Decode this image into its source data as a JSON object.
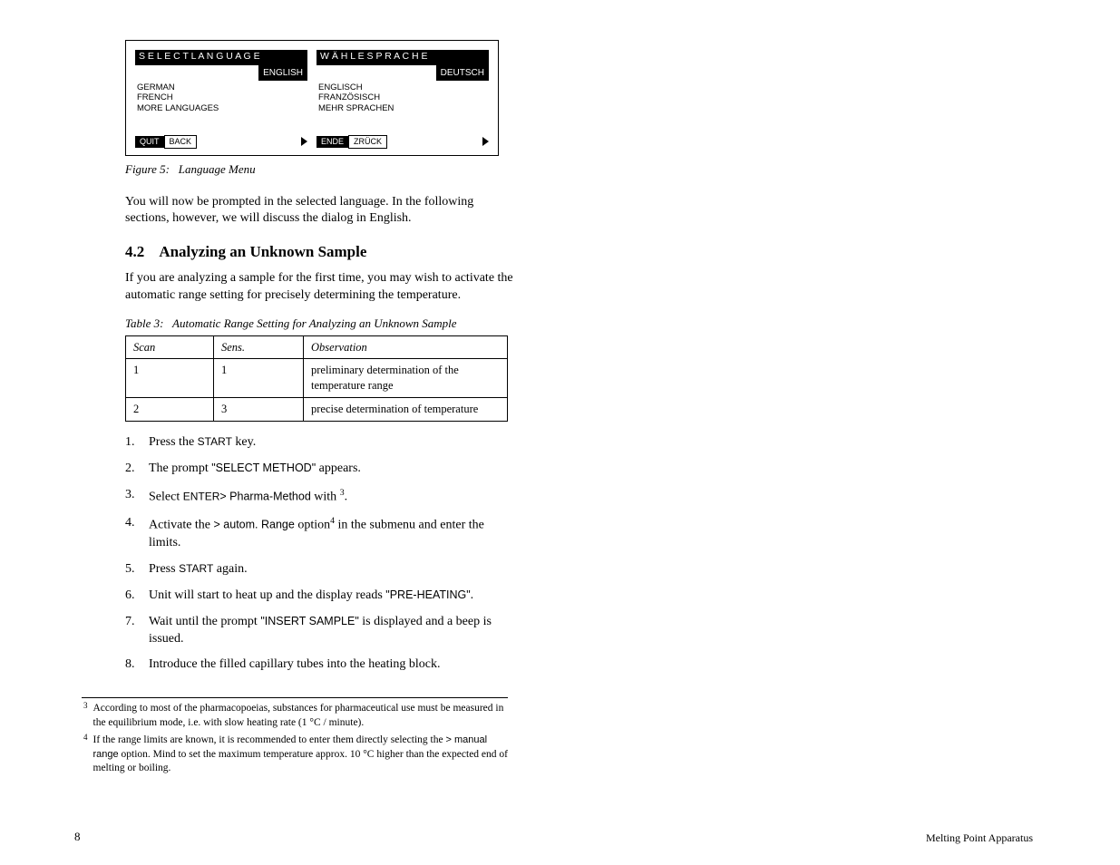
{
  "figure": {
    "panels": [
      {
        "title": "S E L E C T   L A N G U A G E",
        "selected": "ENGLISH",
        "lines": [
          "GERMAN",
          "FRENCH",
          "",
          "MORE LANGUAGES"
        ],
        "foot_left_inv": "QUIT",
        "foot_left_box": "BACK"
      },
      {
        "title": "W Ä H L E   S P R A C H E",
        "selected": "DEUTSCH",
        "lines": [
          "ENGLISCH",
          "FRANZÖSISCH",
          "",
          "MEHR SPRACHEN"
        ],
        "foot_left_inv": "ENDE",
        "foot_left_box": "ZRÜCK"
      }
    ],
    "caption_label": "Figure 5:",
    "caption_text": "Language Menu"
  },
  "para1": "You will now be prompted in the selected language. In the following sections, however, we will discuss the dialog in English.",
  "section": {
    "number": "4.2",
    "title": "Analyzing an Unknown Sample",
    "intro": "If you are analyzing a sample for the first time, you may wish to activate the automatic range setting for precisely determining the temperature."
  },
  "table": {
    "caption_label": "Table 3:",
    "caption_text": "Automatic Range Setting for Analyzing an Unknown Sample",
    "rows": [
      [
        "Scan",
        "Sens.",
        "Observation"
      ],
      [
        "1",
        "1",
        "preliminary determination of the temperature range"
      ],
      [
        "2",
        "3",
        "precise determination of temperature"
      ]
    ]
  },
  "steps": [
    {
      "n": "1.",
      "t_pre": "Press the ",
      "key": "START",
      "t_post": " key."
    },
    {
      "n": "2.",
      "t_pre": "The prompt ",
      "code": "\"SELECT METHOD\"",
      "t_post": " appears."
    },
    {
      "n": "3.",
      "t_pre": "Select ",
      "code": "> Pharma-Method",
      "t_mid": " with ",
      "key": "ENTER",
      "t_post2": "",
      "sup": "3",
      "t_post3": "."
    },
    {
      "n": "4.",
      "t_pre": "Activate the ",
      "code": "> autom. Range",
      "t_mid": " option",
      "sup": "4",
      "t_post": " in the submenu and enter the limits."
    },
    {
      "n": "5.",
      "t_pre": "Press ",
      "key": "START",
      "t_post": " again."
    },
    {
      "n": "6.",
      "t_pre": "Unit will start to heat up and the display reads ",
      "code": "\"PRE-HEATING\"",
      "t_post": "."
    },
    {
      "n": "7.",
      "t_pre": "Wait until the prompt ",
      "code": "\"INSERT SAMPLE\"",
      "t_post": " is displayed and a beep is issued."
    },
    {
      "n": "8.",
      "t_pre": "Introduce the filled capillary tubes into the heating block.",
      "t_post": ""
    }
  ],
  "footnotes": [
    {
      "n": "3",
      "t": "According to most of the pharmacopoeias, substances for pharmaceutical use must be measured in the equilibrium mode, i.e. with slow heating rate (1 °C / minute)."
    },
    {
      "n": "4",
      "t_pre": "If the range limits are known, it is recommended to enter them directly selecting the ",
      "code": "> manual range",
      "t_post": " option. Mind to set the maximum temperature approx. 10 °C higher than the expected end of melting or boiling."
    }
  ],
  "footer": {
    "page": "8",
    "right": "Melting Point Apparatus"
  }
}
